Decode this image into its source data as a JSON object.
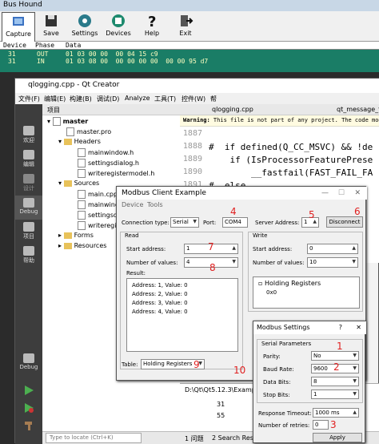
{
  "bushound": {
    "title": "Bus Hound",
    "toolbar": [
      {
        "label": "Capture",
        "icon": "capture-icon"
      },
      {
        "label": "Save",
        "icon": "floppy-icon"
      },
      {
        "label": "Settings",
        "icon": "gear-icon"
      },
      {
        "label": "Devices",
        "icon": "devices-icon"
      },
      {
        "label": "Help",
        "icon": "help-icon"
      },
      {
        "label": "Exit",
        "icon": "exit-icon"
      }
    ],
    "columns": [
      "Device",
      "Phase",
      "Data"
    ],
    "rows": [
      {
        "device": "31",
        "phase": "OUT",
        "data": "01 03 00 00  00 04 15 c9"
      },
      {
        "device": "31",
        "phase": "IN",
        "data": "01 03 08 00  00 00 00 00  00 00 95 d7"
      }
    ]
  },
  "qt": {
    "title": "qlogging.cpp - Qt Creator",
    "menu": [
      "文件(F)",
      "编辑(E)",
      "构建(B)",
      "调试(D)",
      "Analyze",
      "工具(T)",
      "控件(W)",
      "帮"
    ],
    "sidebar": [
      {
        "label": "欢迎"
      },
      {
        "label": "编辑"
      },
      {
        "label": "设计"
      },
      {
        "label": "Debug"
      },
      {
        "label": "项目"
      },
      {
        "label": "帮助"
      }
    ],
    "sidebar_bottom": {
      "label": "Debug"
    },
    "project_header": "项目",
    "tree": {
      "root": "master",
      "pro": "master.pro",
      "headers": "Headers",
      "header_files": [
        "mainwindow.h",
        "settingsdialog.h",
        "writeregistermodel.h"
      ],
      "sources": "Sources",
      "source_files": [
        "main.cpp",
        "mainwind",
        "settingsdi",
        "writeregist"
      ],
      "forms": "Forms",
      "resources": "Resources"
    },
    "editor_tab": "qlogging.cpp",
    "editor_tab2": "qt_message_fat",
    "warning_label": "Warning:",
    "warning_text": " This file is not part of any project. The code model might",
    "code_lines": [
      {
        "n": "1887",
        "text": ""
      },
      {
        "n": "1888",
        "text": "#  if defined(Q_CC_MSVC) && !de"
      },
      {
        "n": "1889",
        "text": "    if (IsProcessorFeaturePrese"
      },
      {
        "n": "1890",
        "text": "        __fastfail(FAST_FAIL_FA"
      },
      {
        "n": "1891",
        "text": "#  else"
      }
    ],
    "bottom_path": "D:\\Qt\\Qt5.12.3\\Examp",
    "bottom_lines": [
      "31",
      "55"
    ],
    "locate_placeholder": "Type to locate (Ctrl+K)",
    "status_tabs": [
      "1 问题",
      "2 Search Results"
    ]
  },
  "modbus_client": {
    "title": "Modbus Client Example",
    "menu": [
      "Device",
      "Tools"
    ],
    "connection_type_label": "Connection type:",
    "connection_type": "Serial",
    "port_label": "Port:",
    "port": "COM4",
    "server_address_label": "Server Address:",
    "server_address": "1",
    "disconnect": "Disconnect",
    "read_group": "Read",
    "write_group": "Write",
    "start_address_label": "Start address:",
    "read_start": "1",
    "write_start": "0",
    "num_values_label": "Number of values:",
    "read_num": "4",
    "write_num": "10",
    "result_label": "Result:",
    "results": [
      "Address: 1, Value: 0",
      "Address: 2, Value: 0",
      "Address: 3, Value: 0",
      "Address: 4, Value: 0"
    ],
    "write_table_header": "Holding Registers",
    "write_row": "0x0",
    "table_label": "Table:",
    "table": "Holding Registers"
  },
  "modbus_settings": {
    "title": "Modbus Settings",
    "group": "Serial Parameters",
    "parity_label": "Parity:",
    "parity": "No",
    "baud_label": "Baud Rate:",
    "baud": "9600",
    "data_bits_label": "Data Bits:",
    "data_bits": "8",
    "stop_bits_label": "Stop Bits:",
    "stop_bits": "1",
    "timeout_label": "Response Timeout:",
    "timeout": "1000 ms",
    "retries_label": "Number of retries:",
    "retries": "0",
    "apply": "Apply"
  },
  "annotations": [
    "1",
    "2",
    "3",
    "4",
    "5",
    "6",
    "7",
    "8",
    "9",
    "10"
  ],
  "colors": {
    "annotation": "#e02020",
    "bushound_bg": "#1e8a6e",
    "qt_sidebar": "#3d3d3d"
  }
}
